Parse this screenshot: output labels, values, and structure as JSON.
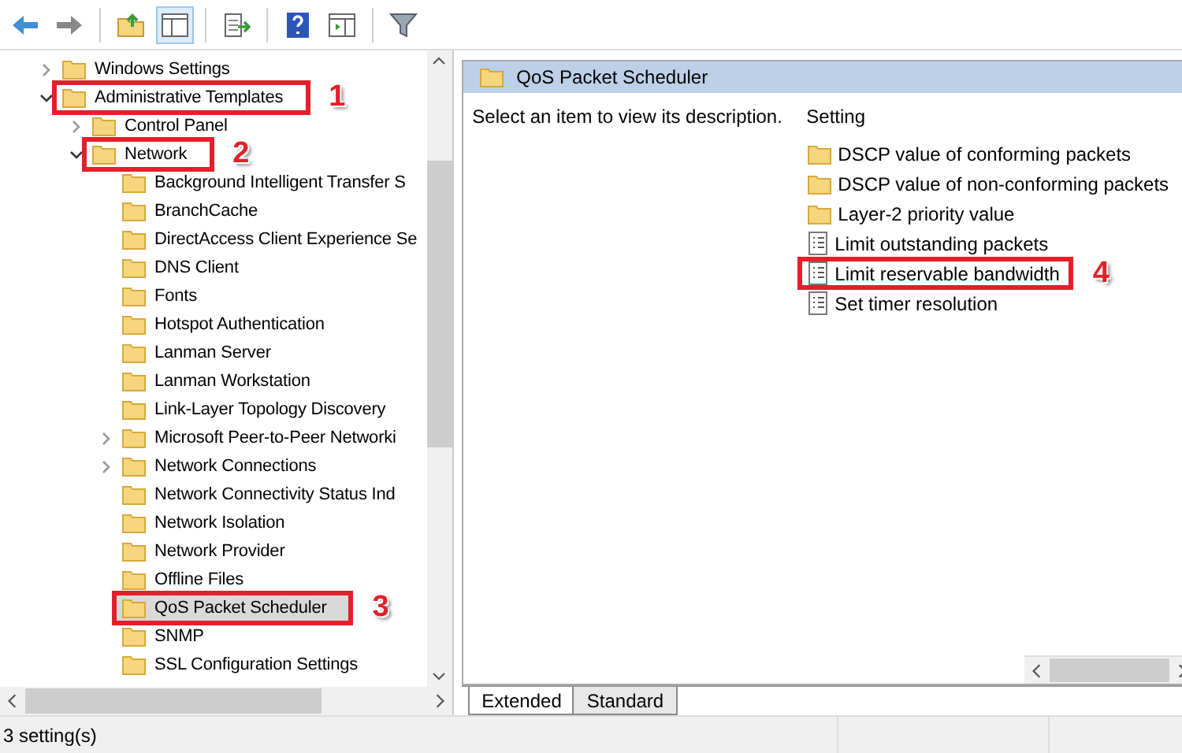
{
  "tree": [
    {
      "label": "Windows Settings",
      "kind": "branch",
      "expanded": false,
      "selected": false
    },
    {
      "label": "Administrative Templates",
      "kind": "branch",
      "expanded": true,
      "selected": false,
      "callout": "1",
      "children": [
        {
          "label": "Control Panel",
          "kind": "branch",
          "expanded": false,
          "selected": false
        },
        {
          "label": "Network",
          "kind": "branch",
          "expanded": true,
          "selected": false,
          "callout": "2",
          "children": [
            {
              "label": "Background Intelligent Transfer S",
              "kind": "leaf",
              "selected": false
            },
            {
              "label": "BranchCache",
              "kind": "leaf",
              "selected": false
            },
            {
              "label": "DirectAccess Client Experience Se",
              "kind": "leaf",
              "selected": false
            },
            {
              "label": "DNS Client",
              "kind": "leaf",
              "selected": false
            },
            {
              "label": "Fonts",
              "kind": "leaf",
              "selected": false
            },
            {
              "label": "Hotspot Authentication",
              "kind": "leaf",
              "selected": false
            },
            {
              "label": "Lanman Server",
              "kind": "leaf",
              "selected": false
            },
            {
              "label": "Lanman Workstation",
              "kind": "leaf",
              "selected": false
            },
            {
              "label": "Link-Layer Topology Discovery",
              "kind": "leaf",
              "selected": false
            },
            {
              "label": "Microsoft Peer-to-Peer Networki",
              "kind": "branch",
              "expanded": false,
              "selected": false
            },
            {
              "label": "Network Connections",
              "kind": "branch",
              "expanded": false,
              "selected": false
            },
            {
              "label": "Network Connectivity Status Ind",
              "kind": "leaf",
              "selected": false
            },
            {
              "label": "Network Isolation",
              "kind": "leaf",
              "selected": false
            },
            {
              "label": "Network Provider",
              "kind": "leaf",
              "selected": false
            },
            {
              "label": "Offline Files",
              "kind": "leaf",
              "selected": false
            },
            {
              "label": "QoS Packet Scheduler",
              "kind": "leaf",
              "selected": true,
              "callout": "3"
            },
            {
              "label": "SNMP",
              "kind": "leaf",
              "selected": false
            },
            {
              "label": "SSL Configuration Settings",
              "kind": "leaf",
              "selected": false
            }
          ]
        }
      ]
    }
  ],
  "details": {
    "title": "QoS Packet Scheduler",
    "description": "Select an item to view its description.",
    "column": "Setting",
    "settings": [
      {
        "kind": "folder",
        "label": "DSCP value of conforming packets"
      },
      {
        "kind": "folder",
        "label": "DSCP value of non-conforming packets"
      },
      {
        "kind": "folder",
        "label": "Layer-2 priority value"
      },
      {
        "kind": "policy",
        "label": "Limit outstanding packets"
      },
      {
        "kind": "policy",
        "label": "Limit reservable bandwidth",
        "callout": "4"
      },
      {
        "kind": "policy",
        "label": "Set timer resolution"
      }
    ]
  },
  "view_tabs": [
    {
      "label": "Extended",
      "selected": true
    },
    {
      "label": "Standard",
      "selected": false
    }
  ],
  "status_bar": "3 setting(s)"
}
